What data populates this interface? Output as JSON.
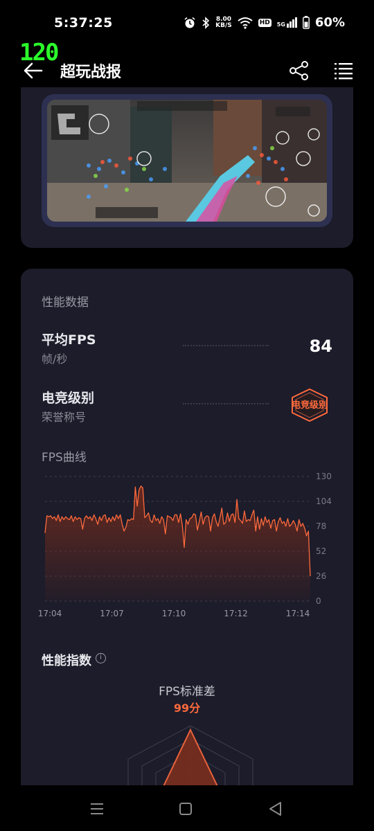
{
  "status": {
    "time": "5:37:25",
    "net_speed_value": "8.00",
    "net_speed_unit": "KB/S",
    "hd": "HD",
    "signal": "5G",
    "battery": "60%"
  },
  "fps_overlay": "120",
  "appbar": {
    "title": "超玩战报"
  },
  "perf": {
    "section_title": "性能数据",
    "avg_fps_label": "平均FPS",
    "avg_fps_sub": "帧/秒",
    "avg_fps_value": "84",
    "level_label": "电竞级别",
    "level_sub": "荣誉称号",
    "level_badge": "电竞级别"
  },
  "chart_data": {
    "type": "area",
    "title": "FPS曲线",
    "ylim": [
      0,
      130
    ],
    "yticks": [
      "130",
      "104",
      "78",
      "52",
      "26",
      "0"
    ],
    "xticks": [
      "17:04",
      "17:07",
      "17:10",
      "17:12",
      "17:14"
    ],
    "grid": true,
    "colors": {
      "line": "#ff6a3d",
      "fill_top": "#6b2a1e",
      "grid": "#3e3e50",
      "tick": "#7a7a88"
    },
    "series": [
      {
        "values": [
          71,
          89,
          88,
          89,
          86,
          88,
          84,
          90,
          83,
          88,
          85,
          88,
          86,
          85,
          89,
          83,
          88,
          85,
          87,
          86,
          75,
          86,
          89,
          86,
          88,
          84,
          90,
          86,
          80,
          88,
          84,
          89,
          90,
          82,
          87,
          83,
          88,
          84,
          90,
          86,
          90,
          80,
          73,
          77,
          85,
          84,
          86,
          85,
          119,
          99,
          116,
          120,
          118,
          87,
          89,
          92,
          84,
          82,
          90,
          84,
          86,
          81,
          88,
          85,
          70,
          89,
          88,
          87,
          84,
          90,
          90,
          82,
          91,
          79,
          56,
          85,
          80,
          86,
          87,
          91,
          90,
          74,
          83,
          93,
          80,
          87,
          89,
          88,
          73,
          87,
          91,
          83,
          78,
          87,
          97,
          80,
          82,
          92,
          83,
          90,
          91,
          82,
          106,
          86,
          84,
          81,
          94,
          83,
          85,
          84,
          90,
          95,
          73,
          88,
          75,
          86,
          79,
          88,
          82,
          85,
          76,
          84,
          85,
          73,
          83,
          87,
          81,
          83,
          78,
          86,
          78,
          80,
          84,
          80,
          73,
          85,
          78,
          81,
          76,
          68,
          73,
          26
        ]
      }
    ]
  },
  "index": {
    "title": "性能指数",
    "std_label": "FPS标准差",
    "std_score": "99分"
  },
  "icons": [
    "back-arrow-icon",
    "share-icon",
    "list-menu-icon",
    "info-icon",
    "alarm-icon",
    "bluetooth-icon",
    "wifi-icon",
    "signal-icon",
    "battery-icon",
    "nav-recent-icon",
    "nav-home-icon",
    "nav-back-icon"
  ]
}
